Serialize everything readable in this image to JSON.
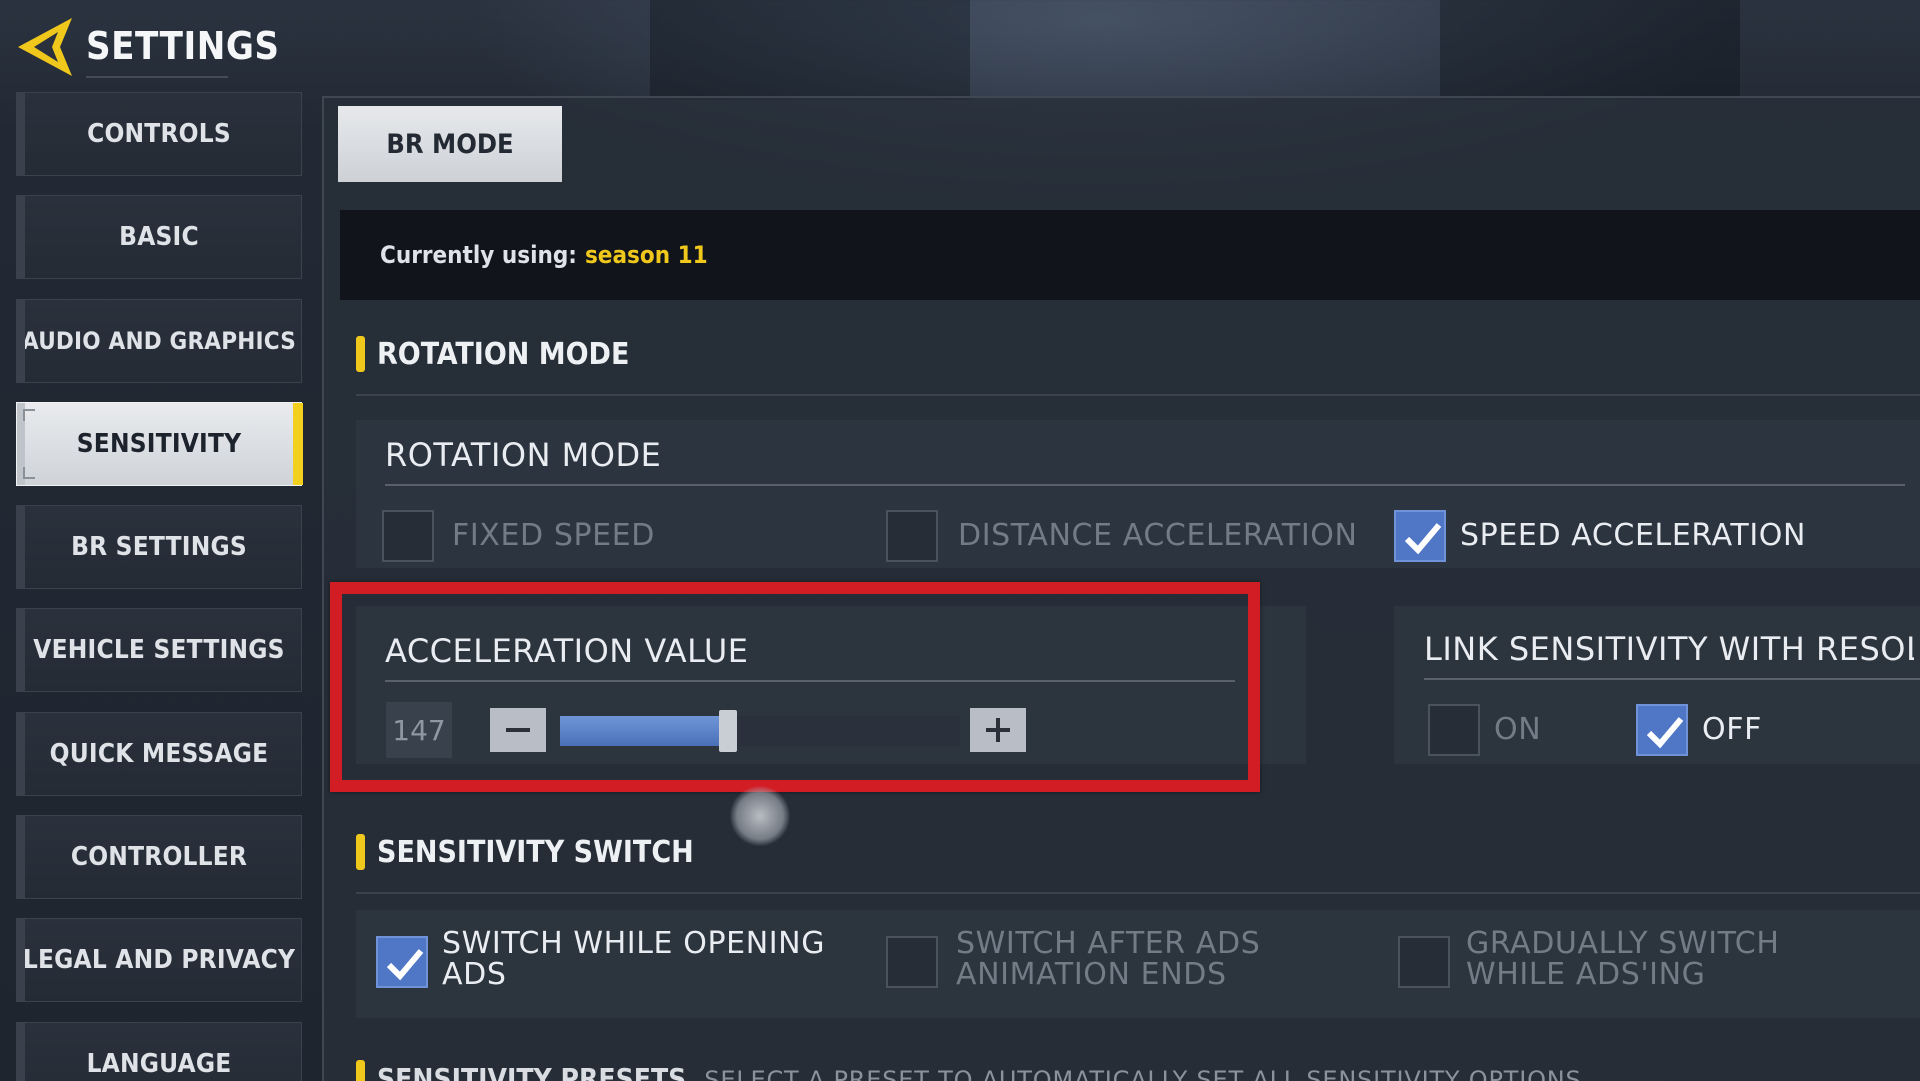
{
  "header": {
    "title": "SETTINGS"
  },
  "sidebar": {
    "items": [
      {
        "label": "CONTROLS"
      },
      {
        "label": "BASIC"
      },
      {
        "label": "AUDIO AND GRAPHICS"
      },
      {
        "label": "SENSITIVITY",
        "active": true
      },
      {
        "label": "BR SETTINGS"
      },
      {
        "label": "VEHICLE SETTINGS"
      },
      {
        "label": "QUICK MESSAGE"
      },
      {
        "label": "CONTROLLER"
      },
      {
        "label": "LEGAL AND PRIVACY"
      },
      {
        "label": "LANGUAGE"
      }
    ]
  },
  "main": {
    "tab": {
      "label": "BR MODE"
    },
    "current": {
      "label": "Currently using:",
      "value": "season 11"
    },
    "rotation_section": {
      "title": "ROTATION MODE",
      "setting_title": "ROTATION MODE",
      "options": [
        {
          "label": "FIXED SPEED",
          "checked": false
        },
        {
          "label": "DISTANCE ACCELERATION",
          "checked": false
        },
        {
          "label": "SPEED ACCELERATION",
          "checked": true
        }
      ]
    },
    "acceleration": {
      "title": "ACCELERATION VALUE",
      "value": "147",
      "slider_fraction": 0.42,
      "minus_icon": "minus-icon",
      "plus_icon": "plus-icon"
    },
    "link_sensitivity": {
      "title": "LINK SENSITIVITY WITH RESOL",
      "on_label": "ON",
      "off_label": "OFF",
      "on_checked": false,
      "off_checked": true
    },
    "switch_section": {
      "title": "SENSITIVITY SWITCH",
      "options": [
        {
          "line1": "SWITCH WHILE OPENING",
          "line2": "ADS",
          "checked": true
        },
        {
          "line1": "SWITCH AFTER ADS",
          "line2": "ANIMATION ENDS",
          "checked": false
        },
        {
          "line1": "GRADUALLY SWITCH",
          "line2": "WHILE ADS'ING",
          "checked": false
        }
      ]
    },
    "presets": {
      "title": "SENSITIVITY PRESETS",
      "description": "SELECT A PRESET TO AUTOMATICALLY SET ALL SENSITIVITY OPTIONS"
    }
  },
  "colors": {
    "accent_yellow": "#f0c81c",
    "check_blue": "#4f77c6",
    "highlight_red": "#d21d25",
    "active_tab_bg": "#e7e9ec"
  }
}
